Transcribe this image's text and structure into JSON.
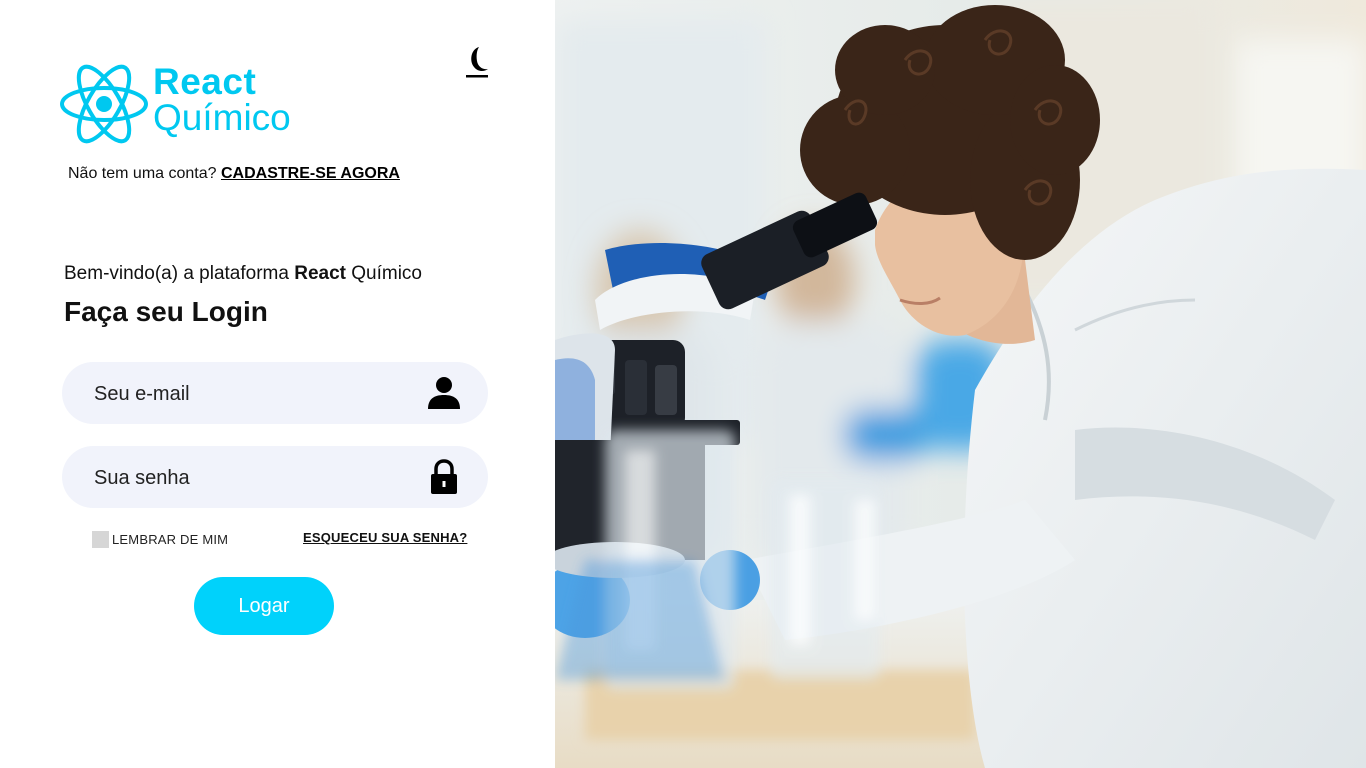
{
  "brand": {
    "name_line1": "React",
    "name_line2": "Químico",
    "accent_color": "#00c8f0"
  },
  "theme_toggle": {
    "icon": "moon-icon"
  },
  "signup": {
    "prompt": "Não tem uma conta?",
    "link_label": "CADASTRE-SE AGORA"
  },
  "welcome": {
    "prefix": "Bem-vindo(a) a plataforma",
    "brand_bold": "React",
    "brand_rest": "Químico"
  },
  "login_title": "Faça seu Login",
  "email_field": {
    "placeholder": "Seu e-mail",
    "value": "",
    "icon": "user-icon"
  },
  "password_field": {
    "placeholder": "Sua senha",
    "value": "",
    "icon": "lock-icon"
  },
  "remember_me": {
    "label": "LEMBRAR DE MIM",
    "checked": false
  },
  "forgot_password": "ESQUECEU SUA SENHA?",
  "login_button": {
    "label": "Logar",
    "color": "#00d2fb"
  }
}
